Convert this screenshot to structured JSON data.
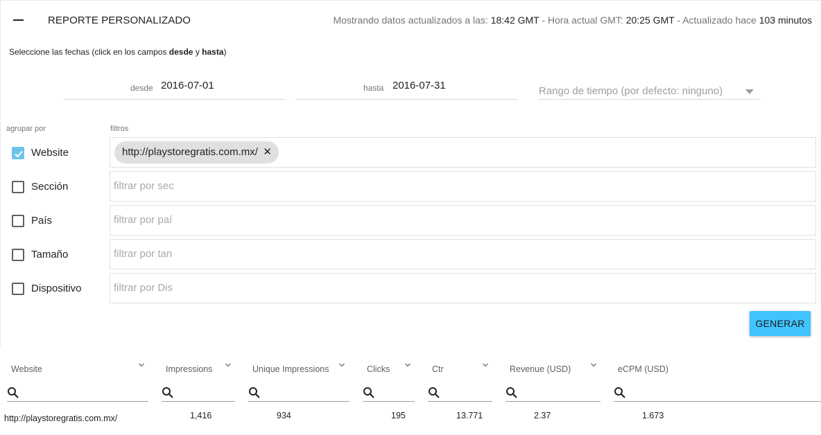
{
  "header": {
    "title": "REPORTE PERSONALIZADO",
    "status_prefix": "Mostrando datos actualizados a las:",
    "updated_time": "18:42 GMT",
    "sep1": "- Hora actual GMT:",
    "current_time": "20:25 GMT",
    "sep2": "- Actualizado hace",
    "ago": "103 minutos"
  },
  "instructions": {
    "text": "Seleccione las fechas (click en los campos",
    "desde": "desde",
    "y": "y",
    "hasta": "hasta",
    "close": ")"
  },
  "dates": {
    "from_label": "desde",
    "from_value": "2016-07-01",
    "to_label": "hasta",
    "to_value": "2016-07-31",
    "range_placeholder": "Rango de tiempo (por defecto: ninguno)"
  },
  "labels": {
    "group_by": "agrupar por",
    "filters": "filtros"
  },
  "groups": [
    {
      "label": "Website",
      "checked": true
    },
    {
      "label": "Sección",
      "checked": false,
      "placeholder": "filtrar por sec"
    },
    {
      "label": "País",
      "checked": false,
      "placeholder": "filtrar por paí"
    },
    {
      "label": "Tamaño",
      "checked": false,
      "placeholder": "filtrar por tan"
    },
    {
      "label": "Dispositivo",
      "checked": false,
      "placeholder": "filtrar por Dis"
    }
  ],
  "website_filter_chip": "http://playstoregratis.com.mx/",
  "generate_label": "GENERAR",
  "colors": {
    "accent": "#40c4ff",
    "checkbox": "#6cc4ec",
    "chip": "#e0e0e0"
  },
  "table": {
    "columns": [
      "Website",
      "Impressions",
      "Unique Impressions",
      "Clicks",
      "Ctr",
      "Revenue (USD)",
      "eCPM (USD)"
    ],
    "rows": [
      [
        "http://playstoregratis.com.mx/",
        "1,416",
        "934",
        "195",
        "13.771",
        "2.37",
        "1.673"
      ]
    ]
  }
}
